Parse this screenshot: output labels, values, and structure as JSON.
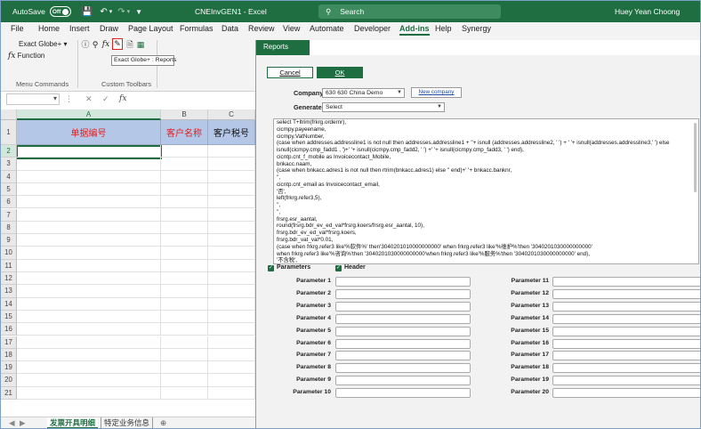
{
  "titlebar": {
    "autosave_label": "AutoSave",
    "autosave_state": "Off",
    "document_title": "CNEInvGEN1 - Excel",
    "search_placeholder": "Search",
    "user_name": "Huey Yean Choong"
  },
  "ribbon_tabs": [
    "File",
    "Home",
    "Insert",
    "Draw",
    "Page Layout",
    "Formulas",
    "Data",
    "Review",
    "View",
    "Automate",
    "Developer",
    "Add-ins",
    "Help",
    "Synergy"
  ],
  "active_ribbon_tab": "Add-ins",
  "ribbon": {
    "exact_globe_label": "Exact Globe+",
    "function_label": "Function",
    "menu_commands_label": "Menu Commands",
    "custom_toolbars_label": "Custom Toolbars",
    "tooltip": "Exact Globe+ : Reports"
  },
  "grid": {
    "columns": [
      "A",
      "B",
      "C"
    ],
    "rows": [
      "1",
      "2",
      "3",
      "4",
      "5",
      "6",
      "7",
      "8",
      "9",
      "10",
      "11",
      "12",
      "13",
      "14",
      "15",
      "16",
      "17",
      "18",
      "19",
      "20",
      "21"
    ],
    "header_cells": [
      "单据编号",
      "客户名称",
      "客户税号"
    ],
    "selected_cell": "A2"
  },
  "sheet_tabs": [
    "发票开具明细",
    "特定业务信息"
  ],
  "active_sheet": "发票开具明细",
  "dialog": {
    "title": "Reports",
    "cancel_label": "Cancel",
    "ok_label": "OK",
    "company_label": "Company",
    "company_value": "630 630 China Demo",
    "new_company_label": "New company",
    "generate_label": "Generate",
    "generate_value": "Select",
    "sql_lines": [
      "select T+ltrim(frkrg.ordernr),",
      "cicmpy.payeename,",
      "cicmpy.VatNumber,",
      "(case when addresses.addressline1 is not null then addresses.addressline1 + ''+  isnull (addresses.addressline2, ' ') + ' '+ isnull(addresses.addressline3,' ') else",
      "isnull(cicmpy.cmp_fadd1 , ')+' '+ isnull(cicmpy.cmp_fadd2, ' ') +' '+ isnull(cicmpy.cmp_fadd3, ' ') end),",
      "cicntp.cnt_f_mobile as Invoicecontact_Mobile,",
      "bnkacc.naam,",
      "(case when bnkacc.adres1 is not null then rtrim(bnkacc.adres1) else '' end)+' '+ bnkacc.banknr,",
      "'',",
      "cicntp.cnt_email as Invoicecontact_email,",
      "'否',",
      "left(frkrg.refer3,5),",
      "'',",
      "'',",
      "frsrg.esr_aantal,",
      "round(frsrg.bdr_ev_ed_val*frsrg.koers/frsrg.esr_aantal, 10),",
      "frsrg.bdr_ev_ed_val*frsrg.koers,",
      "frsrg.bdr_vat_val*0.01,",
      "(case when frkrg.refer3 like'%软件%' then'3040201010000000000' when frkrg.refer3 like'%维护%'then '3040201030000000000'",
      "when frkrg.refer3 like'%咨询%'then '3040201030000000000'when frkrg.refer3 like'%服务%'then '3040201030000000000' end),",
      "'不含税',"
    ],
    "parameters_label": "Parameters",
    "header_label": "Header",
    "parameters_checked": true,
    "header_checked": true,
    "param_labels_left": [
      "Parameter 1",
      "Parameter 2",
      "Parameter 3",
      "Parameter 4",
      "Parameter 5",
      "Parameter 6",
      "Parameter 7",
      "Parameter 8",
      "Parameter 9",
      "Parameter 10"
    ],
    "param_labels_right": [
      "Parameter 11",
      "Parameter 12",
      "Parameter 13",
      "Parameter 14",
      "Parameter 15",
      "Parameter 16",
      "Parameter 17",
      "Parameter 18",
      "Parameter 19",
      "Parameter 20"
    ]
  },
  "colors": {
    "excel_green": "#1e6e41",
    "header_fill": "#b4c7e7",
    "header_text_red": "#e02020"
  }
}
